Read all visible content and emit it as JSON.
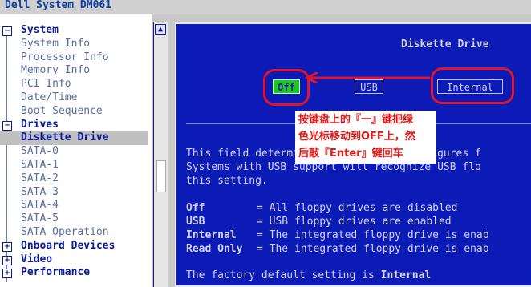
{
  "window": {
    "title": "Dell System DM061"
  },
  "nav": {
    "items": [
      {
        "label": "System",
        "level": 0,
        "expander": "−"
      },
      {
        "label": "System Info",
        "level": 1
      },
      {
        "label": "Processor Info",
        "level": 1
      },
      {
        "label": "Memory Info",
        "level": 1
      },
      {
        "label": "PCI Info",
        "level": 1
      },
      {
        "label": "Date/Time",
        "level": 1
      },
      {
        "label": "Boot Sequence",
        "level": 1
      },
      {
        "label": "Drives",
        "level": 0,
        "expander": "−"
      },
      {
        "label": "Diskette Drive",
        "level": 1,
        "selected": true
      },
      {
        "label": "SATA-0",
        "level": 1
      },
      {
        "label": "SATA-1",
        "level": 1
      },
      {
        "label": "SATA-2",
        "level": 1
      },
      {
        "label": "SATA-3",
        "level": 1
      },
      {
        "label": "SATA-4",
        "level": 1
      },
      {
        "label": "SATA-5",
        "level": 1
      },
      {
        "label": "SATA Operation",
        "level": 1
      },
      {
        "label": "Onboard Devices",
        "level": 0,
        "expander": "+"
      },
      {
        "label": "Video",
        "level": 0,
        "expander": "+"
      },
      {
        "label": "Performance",
        "level": 0,
        "expander": "+"
      }
    ],
    "scroll_up_glyph": "▲"
  },
  "main": {
    "title": "Diskette Drive",
    "options": {
      "off": "Off",
      "usb": "USB",
      "internal": "Internal"
    },
    "selected_option": "Off",
    "callout": {
      "line1": "按键盘上的『一』键把绿",
      "line2": "色光标移动到OFF上，然",
      "line3": "后敲『Enter』键回车"
    },
    "description": [
      "This field determines how the BIOS configures f",
      "Systems with USB support will recognize USB flo",
      "this setting."
    ],
    "legend": [
      {
        "key": "Off",
        "value": "= All floppy drives are disabled"
      },
      {
        "key": "USB",
        "value": "= USB floppy drives are enabled"
      },
      {
        "key": "Internal",
        "value": "= The integrated floppy drive is enab"
      },
      {
        "key": "Read Only",
        "value": "= The integrated floppy drive is enab"
      }
    ],
    "factory_prefix": "The factory default setting is ",
    "factory_value": "Internal"
  },
  "colors": {
    "bios_blue": "#0c1bb5",
    "selection_green": "#21c521",
    "annotation_red": "#e0142a"
  }
}
